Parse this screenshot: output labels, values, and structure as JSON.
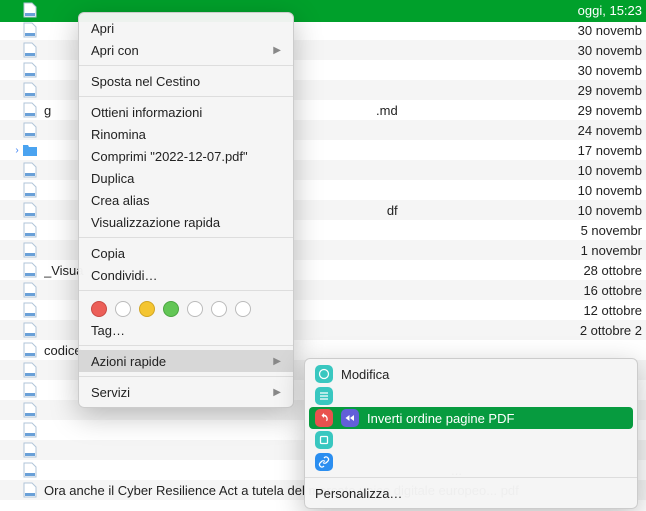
{
  "files": [
    {
      "name": "",
      "date": "oggi, 15:23",
      "type": "file",
      "selected": true
    },
    {
      "name": "",
      "date": "30 novemb",
      "type": "file"
    },
    {
      "name": "",
      "date": "30 novemb",
      "type": "file"
    },
    {
      "name": "",
      "date": "30 novemb",
      "type": "file"
    },
    {
      "name": "",
      "date": "29 novemb",
      "type": "file"
    },
    {
      "name": "g",
      "suffix": ".md",
      "date": "29 novemb",
      "type": "file"
    },
    {
      "name": "",
      "date": "24 novemb",
      "type": "file"
    },
    {
      "name": "",
      "date": "17 novemb",
      "type": "folder",
      "expandable": true
    },
    {
      "name": "",
      "date": "10 novemb",
      "type": "file"
    },
    {
      "name": "",
      "date": "10 novemb",
      "type": "file"
    },
    {
      "name": "",
      "suffix": "df",
      "date": "10 novemb",
      "type": "file"
    },
    {
      "name": "",
      "date": "5 novembr",
      "type": "file"
    },
    {
      "name": "",
      "date": "1 novembr",
      "type": "file"
    },
    {
      "name": "_Visua",
      "date": "28 ottobre",
      "type": "file"
    },
    {
      "name": "",
      "date": "16 ottobre",
      "type": "file"
    },
    {
      "name": "",
      "date": "12 ottobre",
      "type": "file"
    },
    {
      "name": "",
      "date": "2 ottobre 2",
      "type": "file"
    },
    {
      "name": "codice",
      "date": "",
      "type": "file"
    },
    {
      "name": "",
      "date": "",
      "type": "file"
    },
    {
      "name": "",
      "date": "",
      "type": "file"
    },
    {
      "name": "",
      "date": "",
      "type": "file"
    },
    {
      "name": "",
      "date": "",
      "type": "file"
    },
    {
      "name": "",
      "date": "",
      "type": "file"
    },
    {
      "name": "",
      "suffix": "...",
      "date": "",
      "type": "file"
    },
    {
      "name": "Ora anche il Cyber Resilience Act a tutela del mercato unico digitale europeo... pdf",
      "date": "",
      "type": "file"
    }
  ],
  "menu": {
    "apri": "Apri",
    "apri_con": "Apri con",
    "sposta_cestino": "Sposta nel Cestino",
    "ottieni_info": "Ottieni informazioni",
    "rinomina": "Rinomina",
    "comprimi": "Comprimi \"2022-12-07.pdf\"",
    "duplica": "Duplica",
    "crea_alias": "Crea alias",
    "visualizzazione": "Visualizzazione rapida",
    "copia": "Copia",
    "condividi": "Condividi…",
    "tag": "Tag…",
    "azioni_rapide": "Azioni rapide",
    "servizi": "Servizi"
  },
  "submenu": {
    "modifica": "Modifica",
    "inverti": "Inverti ordine pagine PDF",
    "personalizza": "Personalizza…"
  }
}
